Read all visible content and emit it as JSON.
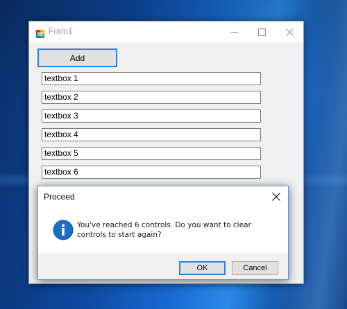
{
  "form": {
    "title": "Form1",
    "add_button_label": "Add",
    "textboxes": [
      "textbox 1",
      "textbox 2",
      "textbox 3",
      "textbox 4",
      "textbox 5",
      "textbox 6"
    ],
    "icons": {
      "app": "winforms-app-icon",
      "minimize": "minimize-icon",
      "maximize": "maximize-icon",
      "close": "close-icon"
    }
  },
  "dialog": {
    "title": "Proceed",
    "message": "You've reached 6 controls. Do you want to clear controls to start again?",
    "ok_label": "OK",
    "cancel_label": "Cancel",
    "icon": "information-icon",
    "icon_color": "#1a6fc4"
  },
  "colors": {
    "accent": "#2f80d6",
    "desktop": "#0e4aa0"
  }
}
